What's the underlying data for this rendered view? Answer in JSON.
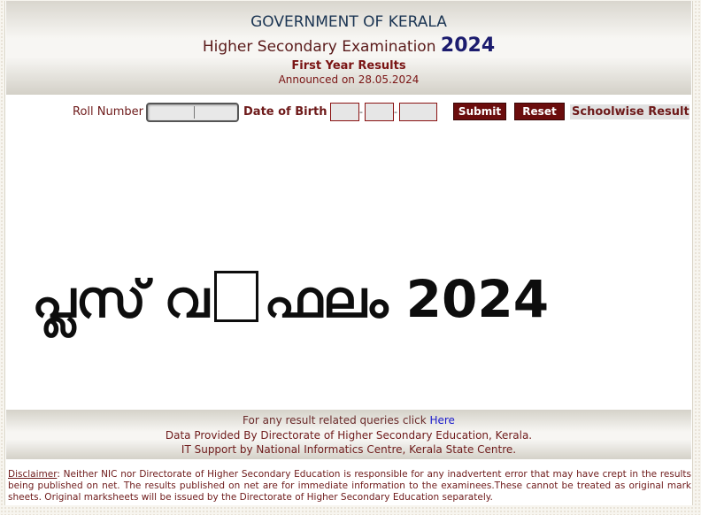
{
  "header": {
    "government": "GOVERNMENT OF KERALA",
    "exam_title": "Higher Secondary Examination",
    "exam_year": "2024",
    "results_label": "First Year Results",
    "announced": "Announced on 28.05.2024"
  },
  "form": {
    "roll_label": "Roll Number",
    "roll_value": "",
    "dob_label": "Date of Birth",
    "dob_day": "",
    "dob_month": "",
    "dob_year": "",
    "submit_label": "Submit",
    "reset_label": "Reset",
    "schoolwise_label": "Schoolwise Result"
  },
  "banner": {
    "text_part1": "പ്ലസ് വ",
    "text_part2": "ഫലം 2024"
  },
  "footer": {
    "queries_text": "For any result related queries click",
    "queries_link": "Here",
    "data_provided": "Data Provided By Directorate of Higher Secondary Education, Kerala.",
    "it_support": "IT Support by National Informatics Centre, Kerala State Centre."
  },
  "disclaimer": {
    "label": "Disclaimer",
    "text": ": Neither NIC nor Directorate of Higher Secondary Education is responsible for any inadvertent error that may have crept in the results being published on net. The results published on net are for immediate information to the examinees.These cannot be treated as original mark sheets. Original marksheets will be issued by the Directorate of Higher Secondary Education separately."
  }
}
